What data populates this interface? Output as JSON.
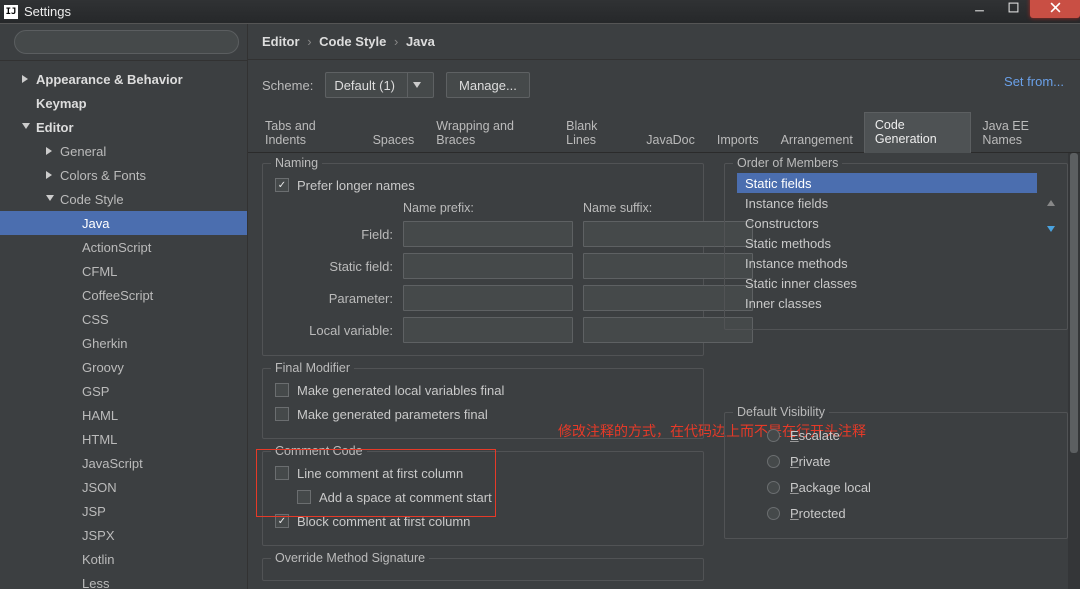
{
  "window": {
    "title": "Settings"
  },
  "search": {
    "placeholder": ""
  },
  "tree": {
    "appearance": "Appearance & Behavior",
    "keymap": "Keymap",
    "editor": "Editor",
    "general": "General",
    "colorsfonts": "Colors & Fonts",
    "codestyle": "Code Style",
    "items": [
      "Java",
      "ActionScript",
      "CFML",
      "CoffeeScript",
      "CSS",
      "Gherkin",
      "Groovy",
      "GSP",
      "HAML",
      "HTML",
      "JavaScript",
      "JSON",
      "JSP",
      "JSPX",
      "Kotlin",
      "Less"
    ],
    "selected": "Java"
  },
  "breadcrumb": {
    "p1": "Editor",
    "p2": "Code Style",
    "p3": "Java"
  },
  "scheme": {
    "label": "Scheme:",
    "value": "Default (1)",
    "manage": "Manage...",
    "setfrom": "Set from..."
  },
  "tabs": {
    "items": [
      "Tabs and Indents",
      "Spaces",
      "Wrapping and Braces",
      "Blank Lines",
      "JavaDoc",
      "Imports",
      "Arrangement",
      "Code Generation",
      "Java EE Names"
    ],
    "active": "Code Generation"
  },
  "naming": {
    "title": "Naming",
    "prefer_longer": "Prefer longer names",
    "headers": {
      "prefix": "Name prefix:",
      "suffix": "Name suffix:"
    },
    "rows": {
      "field": "Field:",
      "static_field": "Static field:",
      "parameter": "Parameter:",
      "local_variable": "Local variable:"
    }
  },
  "final_modifier": {
    "title": "Final Modifier",
    "local_vars": "Make generated local variables final",
    "params": "Make generated parameters final"
  },
  "comment": {
    "title": "Comment Code",
    "line_first": "Line comment at first column",
    "add_space": "Add a space at comment start",
    "block_first": "Block comment at first column"
  },
  "override_sig": {
    "title": "Override Method Signature"
  },
  "order": {
    "title": "Order of Members",
    "items": [
      "Static fields",
      "Instance fields",
      "Constructors",
      "Static methods",
      "Instance methods",
      "Static inner classes",
      "Inner classes"
    ],
    "selected": "Static fields"
  },
  "visibility": {
    "title": "Default Visibility",
    "options": [
      "Escalate",
      "Private",
      "Package local",
      "Protected"
    ]
  },
  "annotation": {
    "text": "修改注释的方式，在代码边上而不是在行开头注释"
  }
}
